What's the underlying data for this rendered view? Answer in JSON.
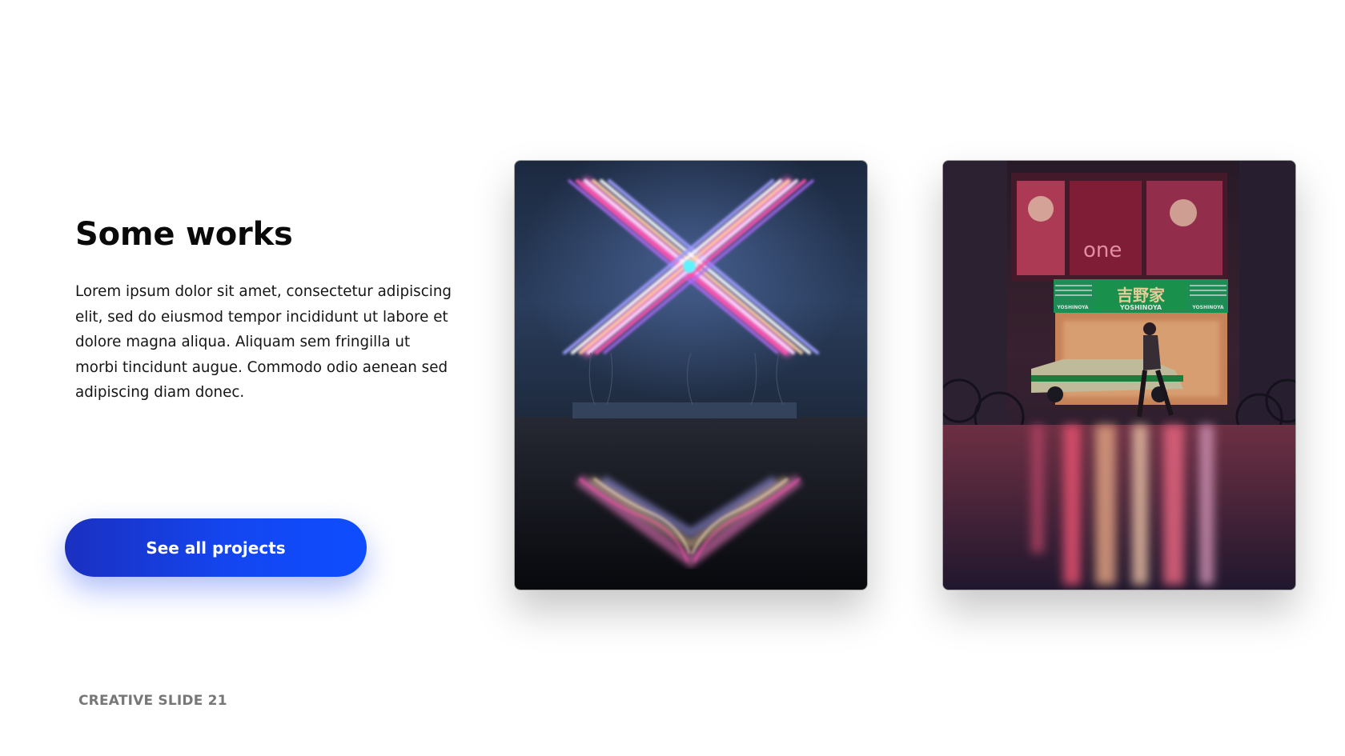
{
  "slide": {
    "title": "Some works",
    "body": "Lorem ipsum dolor sit amet, consectetur adipiscing elit, sed do eiusmod tempor incididunt ut labore et dolore magna aliqua. Aliquam sem fringilla ut morbi tincidunt augue. Commodo odio aenean sed adipiscing diam donec.",
    "cta_label": "See all projects",
    "footer": "CREATIVE SLIDE 21"
  },
  "gallery": {
    "photo_2_signs": {
      "shop_name_jp": "吉野家",
      "shop_name_en": "YOSHINOYA",
      "side_sign": "YOSHINOYA",
      "poster_text": "one"
    }
  },
  "colors": {
    "accent_start": "#1a30c0",
    "accent_end": "#0e4dff",
    "title": "#0a0a0a",
    "footer": "#777777"
  }
}
